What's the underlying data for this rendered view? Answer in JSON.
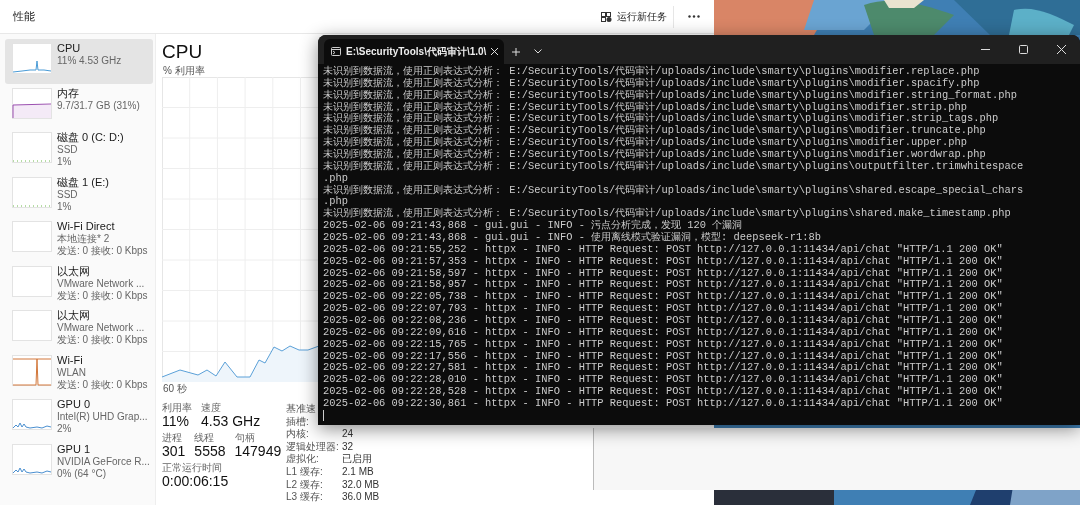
{
  "task_manager": {
    "title": "性能",
    "run_task": "运行新任务",
    "sidebar": {
      "items": [
        {
          "kind": "cpu",
          "name": "CPU",
          "details": [
            "11% 4.53 GHz"
          ],
          "selected": true
        },
        {
          "kind": "memory",
          "name": "内存",
          "details": [
            "9.7/31.7 GB (31%)"
          ],
          "selected": false
        },
        {
          "kind": "disk",
          "name": "磁盘 0 (C: D:)",
          "details": [
            "SSD",
            "1%"
          ],
          "selected": false
        },
        {
          "kind": "disk",
          "name": "磁盘 1 (E:)",
          "details": [
            "SSD",
            "1%"
          ],
          "selected": false
        },
        {
          "kind": "network",
          "traffic": false,
          "name": "Wi-Fi Direct",
          "details": [
            "本地连接* 2",
            "发送: 0 接收: 0 Kbps"
          ],
          "selected": false
        },
        {
          "kind": "network",
          "traffic": false,
          "name": "以太网",
          "details": [
            "VMware Network ...",
            "发送: 0 接收: 0 Kbps"
          ],
          "selected": false
        },
        {
          "kind": "network",
          "traffic": false,
          "name": "以太网",
          "details": [
            "VMware Network ...",
            "发送: 0 接收: 0 Kbps"
          ],
          "selected": false
        },
        {
          "kind": "network",
          "traffic": true,
          "name": "Wi-Fi",
          "details": [
            "WLAN",
            "发送: 0 接收: 0 Kbps"
          ],
          "selected": false
        },
        {
          "kind": "gpu",
          "name": "GPU 0",
          "details": [
            "Intel(R) UHD Grap...",
            "2%"
          ],
          "selected": false
        },
        {
          "kind": "gpu",
          "name": "GPU 1",
          "details": [
            "NVIDIA GeForce R...",
            "0% (64 °C)"
          ],
          "selected": false
        }
      ]
    },
    "cpu_panel": {
      "title": "CPU",
      "graph_label": "% 利用率",
      "time_label": "60 秒",
      "stats": [
        {
          "label": "利用率",
          "value": "11%"
        },
        {
          "label": "速度",
          "value": "4.53 GHz"
        }
      ],
      "counts": [
        {
          "label": "进程",
          "value": "301"
        },
        {
          "label": "线程",
          "value": "5558"
        },
        {
          "label": "句柄",
          "value": "147949"
        }
      ],
      "uptime": {
        "label": "正常运行时间",
        "value": "0:00:06:15"
      },
      "specs": [
        {
          "label": "基准速"
        },
        {
          "label": "插槽:"
        },
        {
          "label": "内核:",
          "value": "24"
        },
        {
          "label": "逻辑处理器:",
          "value": "32"
        },
        {
          "label": "虚拟化:",
          "value": "已启用"
        },
        {
          "label": "L1 缓存:",
          "value": "2.1 MB"
        },
        {
          "label": "L2 缓存:",
          "value": "32.0 MB"
        },
        {
          "label": "L3 缓存:",
          "value": "36.0 MB"
        }
      ]
    }
  },
  "terminal": {
    "tab_title": "E:\\SecurityTools\\代码审计\\1.0\\",
    "lines": [
      "未识别到数据流，使用正则表达式分析： E:/SecurityTools/代码审计/uploads/include\\smarty\\plugins\\modifier.replace.php",
      "未识别到数据流，使用正则表达式分析： E:/SecurityTools/代码审计/uploads/include\\smarty\\plugins\\modifier.spacify.php",
      "未识别到数据流，使用正则表达式分析： E:/SecurityTools/代码审计/uploads/include\\smarty\\plugins\\modifier.string_format.php",
      "未识别到数据流，使用正则表达式分析： E:/SecurityTools/代码审计/uploads/include\\smarty\\plugins\\modifier.strip.php",
      "未识别到数据流，使用正则表达式分析： E:/SecurityTools/代码审计/uploads/include\\smarty\\plugins\\modifier.strip_tags.php",
      "未识别到数据流，使用正则表达式分析： E:/SecurityTools/代码审计/uploads/include\\smarty\\plugins\\modifier.truncate.php",
      "未识别到数据流，使用正则表达式分析： E:/SecurityTools/代码审计/uploads/include\\smarty\\plugins\\modifier.upper.php",
      "未识别到数据流，使用正则表达式分析： E:/SecurityTools/代码审计/uploads/include\\smarty\\plugins\\modifier.wordwrap.php",
      "未识别到数据流，使用正则表达式分析： E:/SecurityTools/代码审计/uploads/include\\smarty\\plugins\\outputfilter.trimwhitespace",
      ".php",
      "未识别到数据流，使用正则表达式分析： E:/SecurityTools/代码审计/uploads/include\\smarty\\plugins\\shared.escape_special_chars",
      ".php",
      "未识别到数据流，使用正则表达式分析： E:/SecurityTools/代码审计/uploads/include\\smarty\\plugins\\shared.make_timestamp.php",
      "2025-02-06 09:21:43,868 - gui.gui - INFO - 污点分析完成，发现 120 个漏洞",
      "2025-02-06 09:21:43,868 - gui.gui - INFO - 使用离线模式验证漏洞，模型: deepseek-r1:8b",
      "2025-02-06 09:21:55,252 - httpx - INFO - HTTP Request: POST http://127.0.0.1:11434/api/chat \"HTTP/1.1 200 OK\"",
      "2025-02-06 09:21:57,353 - httpx - INFO - HTTP Request: POST http://127.0.0.1:11434/api/chat \"HTTP/1.1 200 OK\"",
      "2025-02-06 09:21:58,597 - httpx - INFO - HTTP Request: POST http://127.0.0.1:11434/api/chat \"HTTP/1.1 200 OK\"",
      "2025-02-06 09:21:58,957 - httpx - INFO - HTTP Request: POST http://127.0.0.1:11434/api/chat \"HTTP/1.1 200 OK\"",
      "2025-02-06 09:22:05,738 - httpx - INFO - HTTP Request: POST http://127.0.0.1:11434/api/chat \"HTTP/1.1 200 OK\"",
      "2025-02-06 09:22:07,793 - httpx - INFO - HTTP Request: POST http://127.0.0.1:11434/api/chat \"HTTP/1.1 200 OK\"",
      "2025-02-06 09:22:08,236 - httpx - INFO - HTTP Request: POST http://127.0.0.1:11434/api/chat \"HTTP/1.1 200 OK\"",
      "2025-02-06 09:22:09,616 - httpx - INFO - HTTP Request: POST http://127.0.0.1:11434/api/chat \"HTTP/1.1 200 OK\"",
      "2025-02-06 09:22:15,765 - httpx - INFO - HTTP Request: POST http://127.0.0.1:11434/api/chat \"HTTP/1.1 200 OK\"",
      "2025-02-06 09:22:17,556 - httpx - INFO - HTTP Request: POST http://127.0.0.1:11434/api/chat \"HTTP/1.1 200 OK\"",
      "2025-02-06 09:22:27,581 - httpx - INFO - HTTP Request: POST http://127.0.0.1:11434/api/chat \"HTTP/1.1 200 OK\"",
      "2025-02-06 09:22:28,010 - httpx - INFO - HTTP Request: POST http://127.0.0.1:11434/api/chat \"HTTP/1.1 200 OK\"",
      "2025-02-06 09:22:28,528 - httpx - INFO - HTTP Request: POST http://127.0.0.1:11434/api/chat \"HTTP/1.1 200 OK\"",
      "2025-02-06 09:22:30,861 - httpx - INFO - HTTP Request: POST http://127.0.0.1:11434/api/chat \"HTTP/1.1 200 OK\""
    ]
  }
}
